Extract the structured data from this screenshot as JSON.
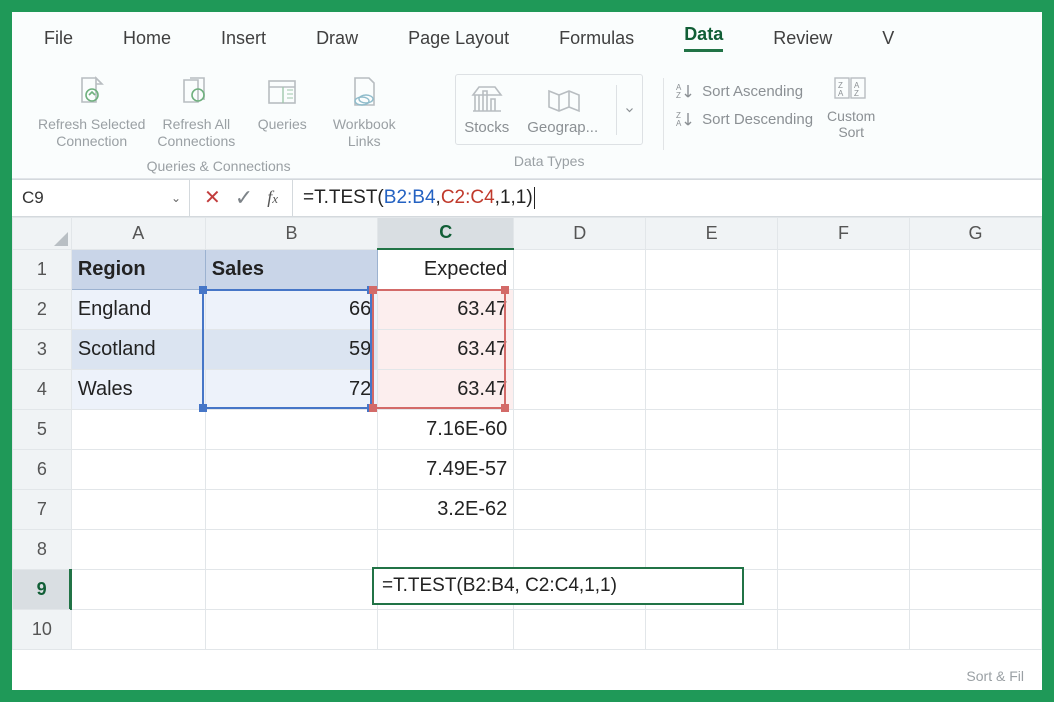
{
  "tabs": {
    "file": "File",
    "home": "Home",
    "insert": "Insert",
    "draw": "Draw",
    "page_layout": "Page Layout",
    "formulas": "Formulas",
    "data": "Data",
    "review": "Review",
    "view": "V"
  },
  "ribbon": {
    "refresh_selected": "Refresh Selected\nConnection",
    "refresh_all": "Refresh All\nConnections",
    "queries": "Queries",
    "workbook_links": "Workbook\nLinks",
    "group_queries": "Queries & Connections",
    "stocks": "Stocks",
    "geography": "Geograp...",
    "group_datatypes": "Data Types",
    "sort_asc": "Sort Ascending",
    "sort_desc": "Sort Descending",
    "custom_sort": "Custom\nSort",
    "group_sort": "Sort & Fil"
  },
  "name_box": "C9",
  "formula": {
    "prefix": "=T.TEST(",
    "range1": "B2:B4",
    "mid": ", ",
    "range2": "C2:C4",
    "suffix": ",1,1)"
  },
  "columns": [
    "A",
    "B",
    "C",
    "D",
    "E",
    "F",
    "G"
  ],
  "rows": [
    "1",
    "2",
    "3",
    "4",
    "5",
    "6",
    "7",
    "8",
    "9",
    "10"
  ],
  "cells": {
    "A1": "Region",
    "B1": "Sales",
    "C1": "Expected",
    "A2": "England",
    "B2": "66",
    "C2": "63.47",
    "A3": "Scotland",
    "B3": "59",
    "C3": "63.47",
    "A4": "Wales",
    "B4": "72",
    "C4": "63.47",
    "C5": "7.16E-60",
    "C6": "7.49E-57",
    "C7": "3.2E-62"
  },
  "editing_formula": "=T.TEST(B2:B4, C2:C4,1,1)",
  "chart_data": {
    "type": "table",
    "title": "",
    "columns": [
      "Region",
      "Sales",
      "Expected"
    ],
    "rows": [
      [
        "England",
        66,
        63.47
      ],
      [
        "Scotland",
        59,
        63.47
      ],
      [
        "Wales",
        72,
        63.47
      ]
    ],
    "extra_values_column_C": [
      "7.16E-60",
      "7.49E-57",
      "3.2E-62"
    ],
    "active_cell": "C9",
    "active_formula": "=T.TEST(B2:B4, C2:C4,1,1)"
  }
}
